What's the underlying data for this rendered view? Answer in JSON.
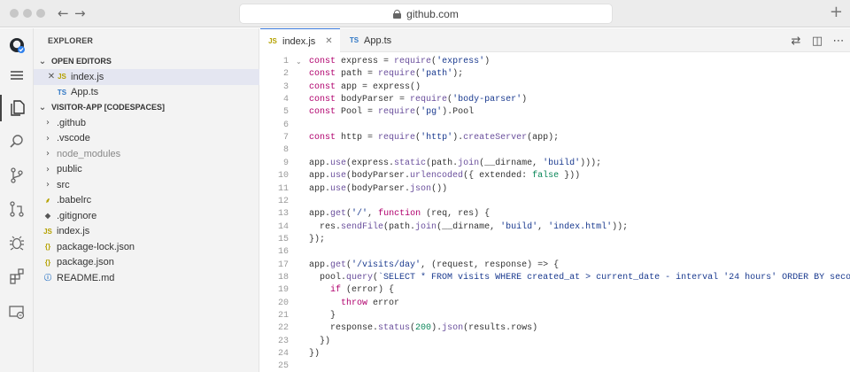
{
  "browser": {
    "url": "github.com",
    "new_tab_symbol": "+"
  },
  "sidebar": {
    "title": "EXPLORER",
    "open_editors_label": "OPEN EDITORS",
    "open_editors": [
      {
        "name": "index.js",
        "icon": "JS",
        "selected": true
      },
      {
        "name": "App.ts",
        "icon": "TS",
        "selected": false
      }
    ],
    "project_label": "VISITOR-APP [CODESPACES]",
    "files": [
      {
        "name": ".github",
        "type": "folder"
      },
      {
        "name": ".vscode",
        "type": "folder"
      },
      {
        "name": "node_modules",
        "type": "folder"
      },
      {
        "name": "public",
        "type": "folder"
      },
      {
        "name": "src",
        "type": "folder"
      },
      {
        "name": ".babelrc",
        "type": "babel"
      },
      {
        "name": ".gitignore",
        "type": "git"
      },
      {
        "name": "index.js",
        "type": "js",
        "icon": "JS"
      },
      {
        "name": "package-lock.json",
        "type": "json",
        "icon": "{}"
      },
      {
        "name": "package.json",
        "type": "json",
        "icon": "{}"
      },
      {
        "name": "README.md",
        "type": "info"
      }
    ]
  },
  "editor": {
    "tabs": [
      {
        "label": "index.js",
        "icon": "JS",
        "active": true
      },
      {
        "label": "App.ts",
        "icon": "TS",
        "active": false
      }
    ],
    "code_lines": [
      "const express = require('express')",
      "const path = require('path');",
      "const app = express()",
      "const bodyParser = require('body-parser')",
      "const Pool = require('pg').Pool",
      "",
      "const http = require('http').createServer(app);",
      "",
      "app.use(express.static(path.join(__dirname, 'build')));",
      "app.use(bodyParser.urlencoded({ extended: false }))",
      "app.use(bodyParser.json())",
      "",
      "app.get('/', function (req, res) {",
      "  res.sendFile(path.join(__dirname, 'build', 'index.html'));",
      "});",
      "",
      "app.get('/visits/day', (request, response) => {",
      "  pool.query(`SELECT * FROM visits WHERE created_at > current_date - interval '24 hours' ORDER BY seconds A",
      "    if (error) {",
      "      throw error",
      "    }",
      "    response.status(200).json(results.rows)",
      "  })",
      "})",
      ""
    ]
  },
  "colors": {
    "keyword": "#b0006d",
    "identifier": "#0b3e8f",
    "accent_tab": "#3b78d8"
  }
}
